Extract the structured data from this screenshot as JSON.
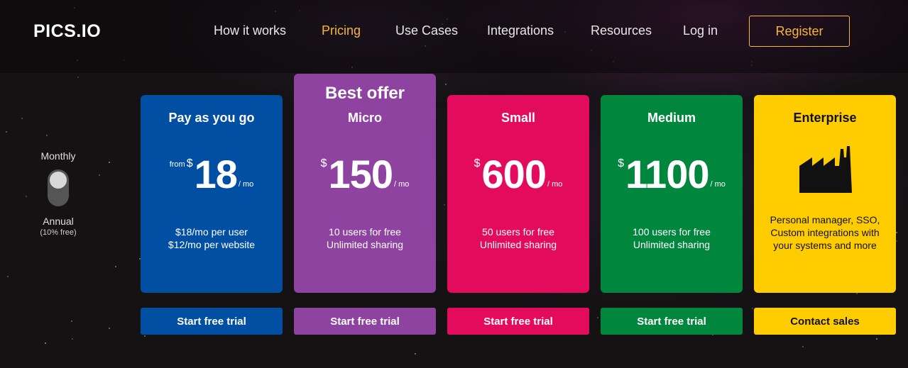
{
  "header": {
    "logo_text": "PICS.IO",
    "nav": [
      {
        "label": "How it works",
        "active": false
      },
      {
        "label": "Pricing",
        "active": true
      },
      {
        "label": "Use Cases",
        "active": false
      },
      {
        "label": "Integrations",
        "active": false
      },
      {
        "label": "Resources",
        "active": false
      },
      {
        "label": "Log in",
        "active": false
      }
    ],
    "register_label": "Register"
  },
  "billing": {
    "monthly_label": "Monthly",
    "annual_label": "Annual",
    "annual_note": "(10% free)"
  },
  "plans": [
    {
      "name": "Pay as you go",
      "from": "from",
      "currency": "$",
      "amount": "18",
      "period": "/ mo",
      "desc1": "$18/mo per user",
      "desc2": "$12/mo per website",
      "cta": "Start free trial",
      "color": "#004fa3"
    },
    {
      "badge": "Best offer",
      "name": "Micro",
      "currency": "$",
      "amount": "150",
      "period": "/ mo",
      "desc1": "10 users for free",
      "desc2": "Unlimited sharing",
      "cta": "Start free trial",
      "color": "#8f43a0"
    },
    {
      "name": "Small",
      "currency": "$",
      "amount": "600",
      "period": "/ mo",
      "desc1": "50 users for free",
      "desc2": "Unlimited sharing",
      "cta": "Start free trial",
      "color": "#e30b5c"
    },
    {
      "name": "Medium",
      "currency": "$",
      "amount": "1100",
      "period": "/ mo",
      "desc1": "100 users for free",
      "desc2": "Unlimited sharing",
      "cta": "Start free trial",
      "color": "#00873d"
    },
    {
      "name": "Enterprise",
      "icon": "factory-icon",
      "desc": "Personal manager, SSO, Custom integrations with your systems and more",
      "cta": "Contact sales",
      "color": "#ffcc00"
    }
  ]
}
